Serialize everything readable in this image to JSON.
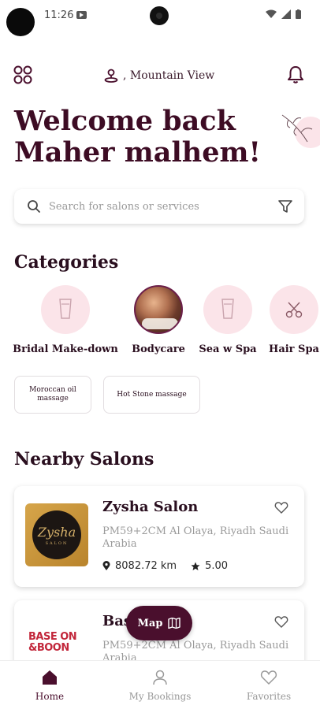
{
  "status_bar": {
    "time": "11:26"
  },
  "header": {
    "location": ", Mountain View"
  },
  "welcome": {
    "line1": "Welcome back",
    "line2": "Maher malhem!"
  },
  "search": {
    "placeholder": "Search for salons or services"
  },
  "categories_section": {
    "title": "Categories",
    "items": [
      {
        "label": "Bridal Make-down",
        "icon": "bottle-icon"
      },
      {
        "label": "Bodycare",
        "icon": "photo"
      },
      {
        "label": "Sea w Spa",
        "icon": "bottle-icon"
      },
      {
        "label": "Hair Spa",
        "icon": "scissors-icon"
      }
    ],
    "chips": [
      {
        "label": "Moroccan oil massage"
      },
      {
        "label": "Hot Stone massage"
      }
    ]
  },
  "nearby": {
    "title": "Nearby Salons",
    "salons": [
      {
        "name": "Zysha Salon",
        "address": "PM59+2CM Al Olaya, Riyadh Saudi Arabia",
        "distance": "8082.72 km",
        "rating": "5.00",
        "logo_script": "Zysha",
        "logo_tag": "SALON"
      },
      {
        "name": "Bas",
        "address": "PM59+2CM Al Olaya, Riyadh Saudi Arabia",
        "logo_line1": "BASE ON",
        "logo_line2": "&BOON"
      }
    ]
  },
  "map_button": {
    "label": "Map"
  },
  "bottom_nav": [
    {
      "label": "Home"
    },
    {
      "label": "My Bookings"
    },
    {
      "label": "Favorites"
    }
  ],
  "colors": {
    "primary": "#4a0f2d",
    "category_bg": "#fbe4e9",
    "text_dark": "#2a0f1f",
    "muted": "#9a9a9a"
  }
}
